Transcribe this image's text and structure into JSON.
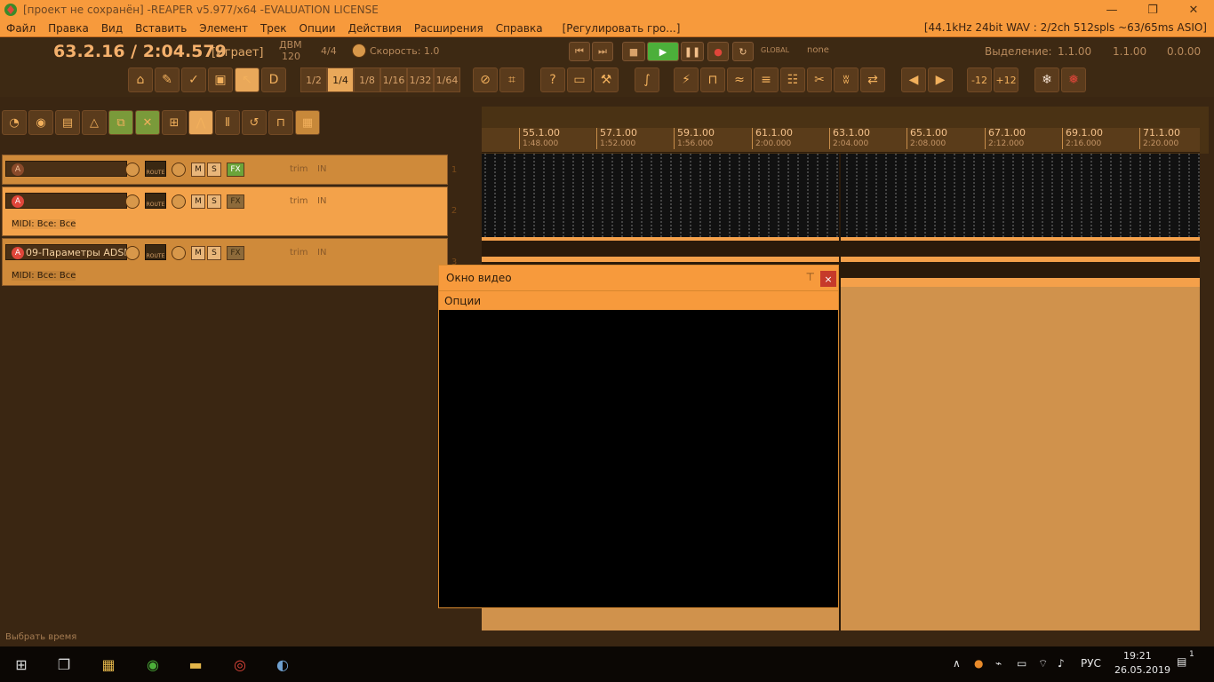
{
  "window": {
    "title": "[проект не сохранён] -REAPER v5.977/x64 -EVALUATION LICENSE"
  },
  "menu": {
    "items": [
      "Файл",
      "Правка",
      "Вид",
      "Вставить",
      "Элемент",
      "Трек",
      "Опции",
      "Действия",
      "Расширения",
      "Справка",
      "[Регулировать гро...]"
    ],
    "status": "[44.1kHz 24bit WAV : 2/2ch 512spls ~63/65ms ASIO]"
  },
  "transport": {
    "time": "63.2.16 / 2:04.579",
    "state": "[Играет]",
    "bpm_label": "ДВМ",
    "bpm": "120",
    "sig": "4/4",
    "speed_label": "Скорость: 1.0",
    "global": "GLOBAL",
    "global_val": "none",
    "selection_label": "Выделение:",
    "sel_start": "1.1.00",
    "sel_end": "1.1.00",
    "sel_len": "0.0.00"
  },
  "grid": {
    "divisions": [
      "1/2",
      "1/4",
      "1/8",
      "1/16",
      "1/32",
      "1/64"
    ],
    "minus12": "-12",
    "plus12": "+12"
  },
  "ruler": [
    {
      "bar": "55.1.00",
      "time": "1:48.000"
    },
    {
      "bar": "57.1.00",
      "time": "1:52.000"
    },
    {
      "bar": "59.1.00",
      "time": "1:56.000"
    },
    {
      "bar": "61.1.00",
      "time": "2:00.000"
    },
    {
      "bar": "63.1.00",
      "time": "2:04.000"
    },
    {
      "bar": "65.1.00",
      "time": "2:08.000"
    },
    {
      "bar": "67.1.00",
      "time": "2:12.000"
    },
    {
      "bar": "69.1.00",
      "time": "2:16.000"
    },
    {
      "bar": "71.1.00",
      "time": "2:20.000"
    }
  ],
  "tracks": [
    {
      "num": "1",
      "name": "",
      "midi": "",
      "route": "ROUTE",
      "m": "M",
      "s": "S",
      "fx": "FX",
      "trim": "trim",
      "in": "IN"
    },
    {
      "num": "2",
      "name": "",
      "midi": "MIDI: Все: Все",
      "route": "ROUTE",
      "m": "M",
      "s": "S",
      "fx": "FX",
      "trim": "trim",
      "in": "IN"
    },
    {
      "num": "3",
      "name": "09-Параметры ADSR",
      "midi": "MIDI: Все: Все",
      "route": "ROUTE",
      "m": "M",
      "s": "S",
      "fx": "FX",
      "trim": "trim",
      "in": "IN"
    }
  ],
  "status": {
    "text": "Выбрать время"
  },
  "video": {
    "title": "Окно видео",
    "menu": "Опции",
    "close": "×"
  },
  "taskbar": {
    "lang": "РУС",
    "time": "19:21",
    "date": "26.05.2019",
    "notif": "1"
  },
  "colors": {
    "accent": "#f79a3c",
    "dark": "#3a2612",
    "play": "#4caf3a"
  }
}
